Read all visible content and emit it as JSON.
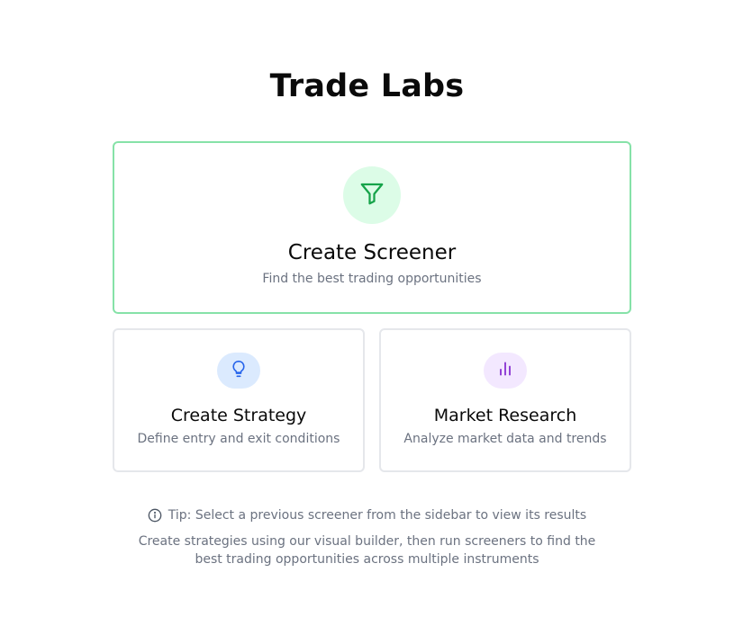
{
  "header": {
    "title": "Trade Labs"
  },
  "cards": {
    "screener": {
      "title": "Create Screener",
      "description": "Find the best trading opportunities",
      "icon": "filter-icon",
      "accent": "#16a34a",
      "icon_bg": "#dcfce7",
      "border": "#86e2a8"
    },
    "strategy": {
      "title": "Create Strategy",
      "description": "Define entry and exit conditions",
      "icon": "lightbulb-icon",
      "accent": "#2563eb",
      "icon_bg": "#dbeafe"
    },
    "research": {
      "title": "Market Research",
      "description": "Analyze market data and trends",
      "icon": "bar-chart-icon",
      "accent": "#7e22ce",
      "icon_bg": "#f3e8ff"
    }
  },
  "footer": {
    "tip_icon": "info-icon",
    "tip": "Tip: Select a previous screener from the sidebar to view its results",
    "description": "Create strategies using our visual builder, then run screeners to find the best trading opportunities across multiple instruments"
  }
}
